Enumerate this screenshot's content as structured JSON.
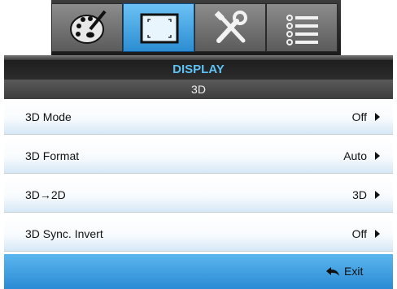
{
  "tabs": [
    {
      "name": "image",
      "icon": "palette-icon"
    },
    {
      "name": "display",
      "icon": "display-frame-icon",
      "active": true
    },
    {
      "name": "setup",
      "icon": "tools-icon"
    },
    {
      "name": "options",
      "icon": "list-icon"
    }
  ],
  "header": {
    "title": "DISPLAY",
    "subtitle": "3D"
  },
  "menu": {
    "items": [
      {
        "label": "3D Mode",
        "value": "Off"
      },
      {
        "label": "3D Format",
        "value": "Auto"
      },
      {
        "label": "3D→2D",
        "value": "3D"
      },
      {
        "label": "3D Sync. Invert",
        "value": "Off"
      }
    ]
  },
  "footer": {
    "exit_label": "Exit",
    "icon": "return-arrow-icon"
  },
  "colors": {
    "accent_blue": "#2c8dd2",
    "header_text": "#5fc2f4",
    "tab_gray": "#7a7a7a"
  }
}
